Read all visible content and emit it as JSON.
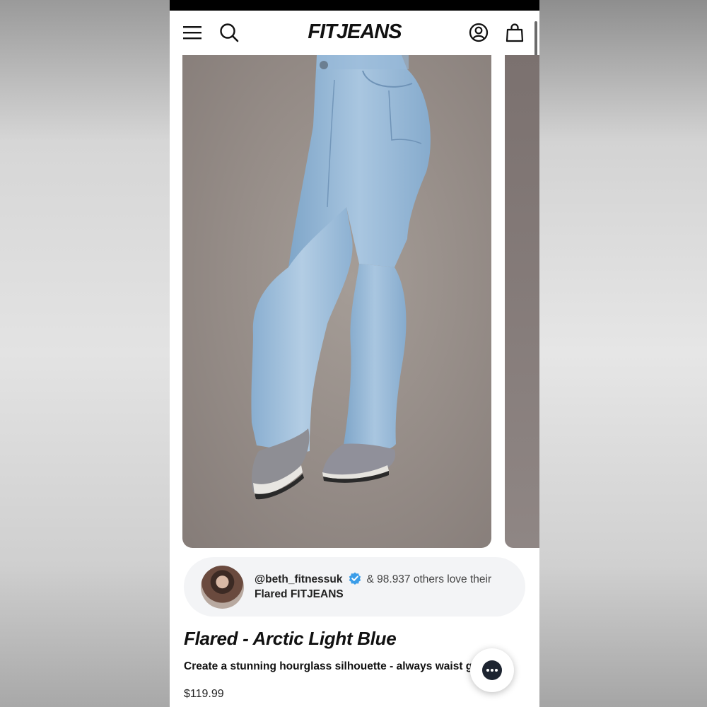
{
  "header": {
    "logo_text": "FITJEANS",
    "icons": [
      "menu-icon",
      "search-icon",
      "account-icon",
      "bag-icon"
    ]
  },
  "gallery": {
    "main_image_subject": "model wearing light blue flared jeans and grey sneakers",
    "peek_image": "next product image"
  },
  "social_proof": {
    "username": "@beth_fitnessuk",
    "others_text": "& 98.937 others love their",
    "product_text": "Flared FITJEANS",
    "verified_color": "#3b9de8"
  },
  "product": {
    "title": "Flared - Arctic Light Blue",
    "description": "Create a stunning hourglass silhouette - always waist ga",
    "price": "$119.99"
  },
  "colors": {
    "background_image": "#948b86",
    "jeans": "#8fb3d4",
    "chat_icon": "#1d2430"
  }
}
